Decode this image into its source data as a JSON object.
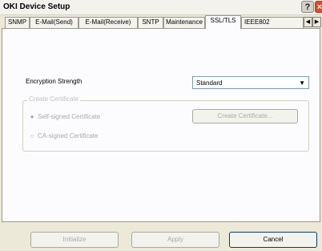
{
  "window": {
    "title": "OKI Device Setup",
    "help_icon": "?",
    "close_icon": "×"
  },
  "tabs": [
    {
      "label": "SNMP"
    },
    {
      "label": "E-Mail(Send)"
    },
    {
      "label": "E-Mail(Receive)"
    },
    {
      "label": "SNTP"
    },
    {
      "label": "Maintenance"
    },
    {
      "label": "SSL/TLS"
    },
    {
      "label": "IEEE802"
    }
  ],
  "tab_scroll": {
    "left": "◀",
    "right": "▶"
  },
  "ssl": {
    "encryption_label": "Encryption Strength",
    "encryption_value": "Standard",
    "dropdown_arrow": "▼",
    "group_title": "Create Certificate",
    "radio_self": "Self-signed Certificate",
    "radio_ca": "CA-signed Certificate",
    "radio_selected_mark": "●",
    "radio_unselected_mark": "○",
    "create_button": "Create Certificate..."
  },
  "footer": {
    "initialize": "Initialize",
    "apply": "Apply",
    "cancel": "Cancel"
  }
}
